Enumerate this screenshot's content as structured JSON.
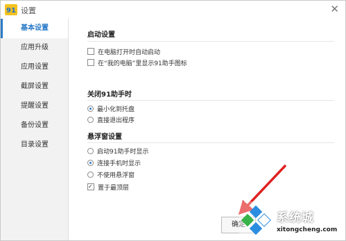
{
  "window": {
    "title": "设置"
  },
  "sidebar": {
    "items": [
      {
        "label": "基本设置",
        "active": true
      },
      {
        "label": "应用升级"
      },
      {
        "label": "应用设置"
      },
      {
        "label": "截屏设置"
      },
      {
        "label": "提醒设置"
      },
      {
        "label": "备份设置"
      },
      {
        "label": "目录设置"
      }
    ]
  },
  "startup": {
    "title": "启动设置",
    "options": [
      {
        "label": "在电脑打开时自动启动",
        "checked": false
      },
      {
        "label": "在“我的电脑”里显示91助手图标",
        "checked": false
      }
    ]
  },
  "close_section": {
    "title": "关闭91助手时",
    "options": [
      {
        "label": "最小化到托盘",
        "selected": true
      },
      {
        "label": "直接退出程序",
        "selected": false
      }
    ]
  },
  "float_section": {
    "title": "悬浮窗设置",
    "options": [
      {
        "label": "启动91助手时显示",
        "selected": false
      },
      {
        "label": "连接手机时显示",
        "selected": true
      },
      {
        "label": "不使用悬浮窗",
        "selected": false
      }
    ],
    "topmost": {
      "label": "置于最顶层",
      "checked": true
    }
  },
  "buttons": {
    "ok": "确定"
  },
  "watermark": {
    "text": "系统城",
    "url": "xitongcheng.com"
  },
  "colors": {
    "accent": "#2a7ac7",
    "arrow": "#e02020"
  }
}
